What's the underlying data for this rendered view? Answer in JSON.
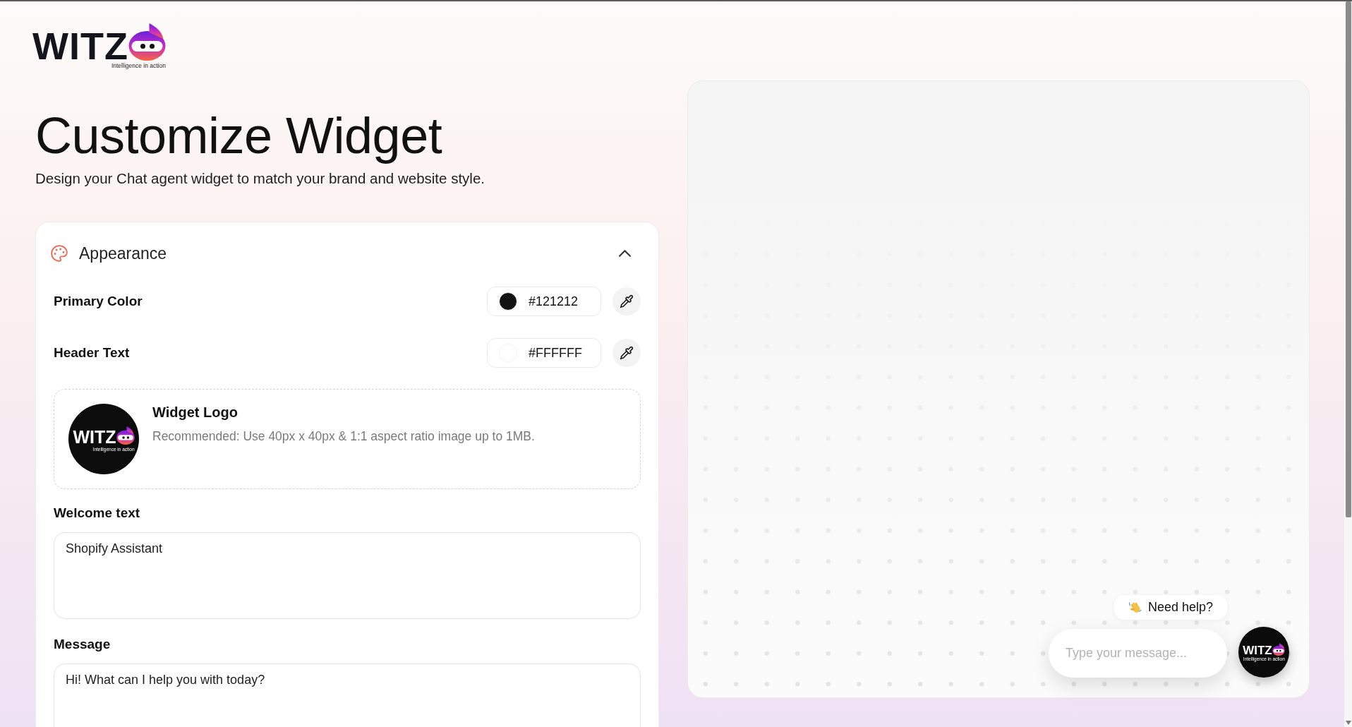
{
  "logo": {
    "wordmark": "WITZ",
    "tagline": "Intelligence in action"
  },
  "header": {
    "title": "Customize Widget",
    "subtitle": "Design your Chat agent widget to match your brand and website style."
  },
  "appearance": {
    "title": "Appearance",
    "expanded": true,
    "color_fields": [
      {
        "label": "Primary Color",
        "value": "#121212",
        "color": "#121212"
      },
      {
        "label": "Header Text",
        "value": "#FFFFFF",
        "color": "#ffffff"
      }
    ],
    "widget_logo": {
      "title": "Widget Logo",
      "hint": "Recommended: Use 40px x 40px & 1:1 aspect ratio image up to 1MB.",
      "logo": {
        "wordmark": "WITZ",
        "tagline": "Intelligence in action"
      }
    },
    "text_fields": [
      {
        "label": "Welcome text",
        "value": "Shopify Assistant"
      },
      {
        "label": "Message",
        "value": "Hi! What can I help you with today?"
      }
    ]
  },
  "preview": {
    "greeting": "Need help?",
    "input": {
      "placeholder": "Type your message..."
    },
    "launcher_logo": {
      "wordmark": "WITZ",
      "tagline": "Intelligence in action"
    }
  }
}
